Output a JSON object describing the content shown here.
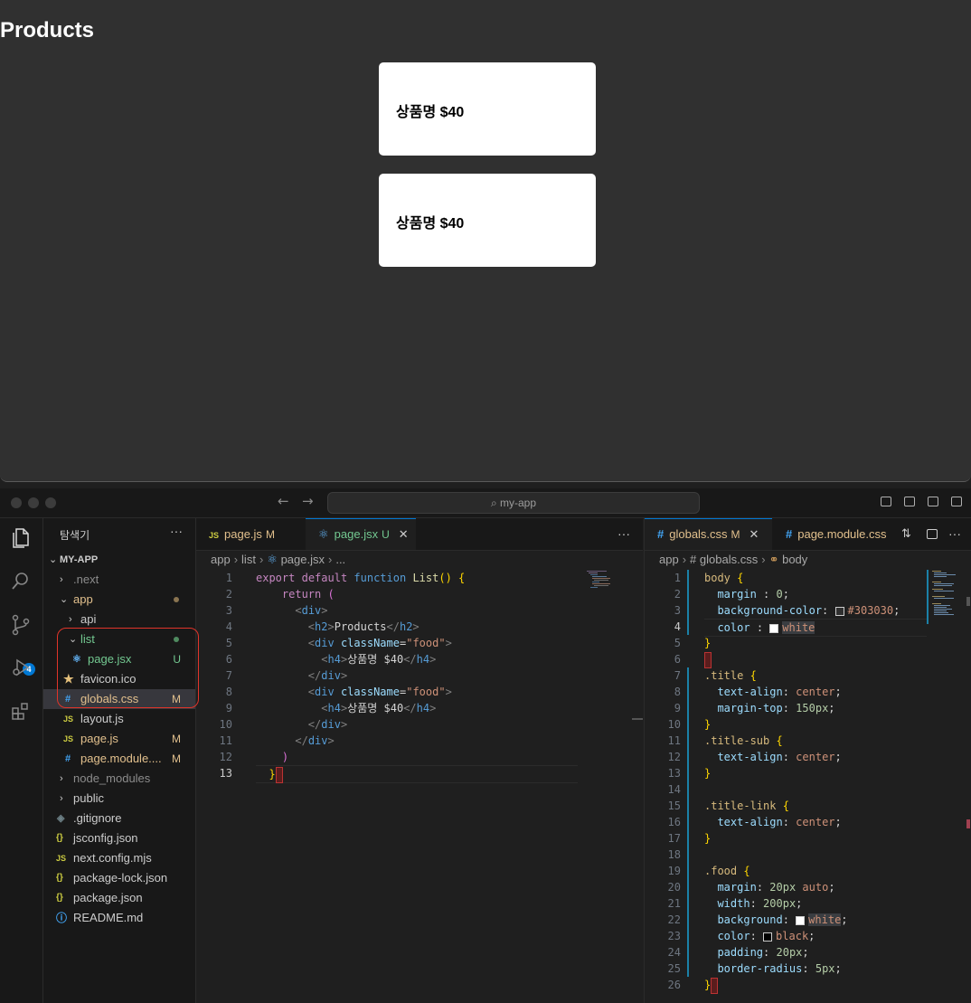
{
  "preview": {
    "heading": "Products",
    "foods": [
      {
        "label": "상품명 $40"
      },
      {
        "label": "상품명 $40"
      }
    ]
  },
  "titlebar": {
    "search_label": "⌕ my-app",
    "back": "←",
    "forward": "→"
  },
  "activity": {
    "scm_badge": "4"
  },
  "sidebar": {
    "title": "탐색기",
    "more": "···",
    "root": "MY-APP",
    "items": [
      {
        "label": ".next",
        "status": ""
      },
      {
        "label": "app",
        "status": ""
      },
      {
        "label": "api",
        "status": ""
      },
      {
        "label": "list",
        "status": ""
      },
      {
        "label": "page.jsx",
        "status": "U"
      },
      {
        "label": "favicon.ico",
        "status": ""
      },
      {
        "label": "globals.css",
        "status": "M"
      },
      {
        "label": "layout.js",
        "status": ""
      },
      {
        "label": "page.js",
        "status": "M"
      },
      {
        "label": "page.module....",
        "status": "M"
      },
      {
        "label": "node_modules",
        "status": ""
      },
      {
        "label": "public",
        "status": ""
      },
      {
        "label": ".gitignore",
        "status": ""
      },
      {
        "label": "jsconfig.json",
        "status": ""
      },
      {
        "label": "next.config.mjs",
        "status": ""
      },
      {
        "label": "package-lock.json",
        "status": ""
      },
      {
        "label": "package.json",
        "status": ""
      },
      {
        "label": "README.md",
        "status": ""
      }
    ]
  },
  "editor1": {
    "tabs": [
      {
        "label": "page.js",
        "status": "M"
      },
      {
        "label": "page.jsx",
        "status": "U"
      }
    ],
    "more": "···",
    "breadcrumb": [
      "app",
      "list",
      "page.jsx",
      "..."
    ]
  },
  "editor2": {
    "tabs": [
      {
        "label": "globals.css",
        "status": "M"
      },
      {
        "label": "page.module.css",
        "status": ""
      }
    ],
    "more": "···",
    "breadcrumb": [
      "app",
      "globals.css",
      "body"
    ]
  },
  "colors": {
    "preview_bg": "#303030",
    "accent": "#0078d4",
    "modified": "#e2c08d",
    "untracked": "#73c991",
    "highlight_box": "#e0342a"
  }
}
